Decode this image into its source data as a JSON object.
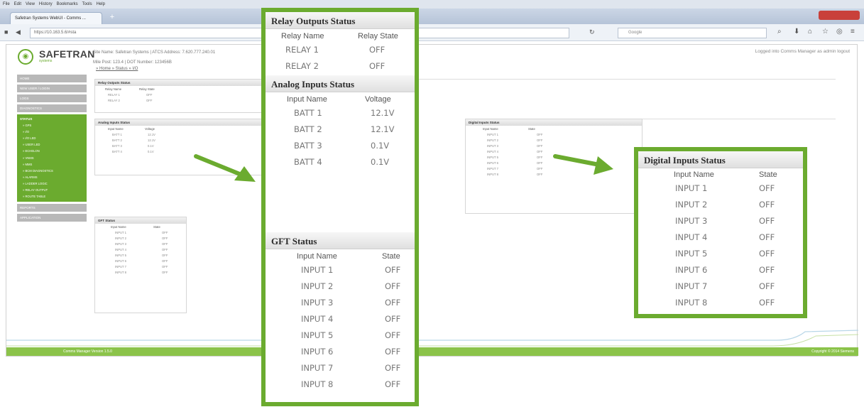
{
  "browser": {
    "menu": [
      "File",
      "Edit",
      "View",
      "History",
      "Bookmarks",
      "Tools",
      "Help"
    ],
    "tab_title": "Safetran Systems WebUI - Comms ...",
    "url": "https://10.163.5.6/#sta",
    "search_placeholder": "Google"
  },
  "header": {
    "logo": "SAFETRAN",
    "logo_sub": "systems",
    "site_line": "Site Name: Safetran Systems | ATCS Address: 7.620.777.240.01",
    "mile_line": "Mile Post: 123.4          | DOT Number: 123456B",
    "breadcrumb": "» Home » Status » I/O",
    "login_text": "Logged into Comms Manager as admin  logout"
  },
  "sidenav": {
    "top_items": [
      "HOME",
      "NEW USER / LOGIN",
      "LOGS",
      "DIAGNOSTICS"
    ],
    "status_group": {
      "label": "STATUS",
      "items": [
        "» GPS",
        "» I/O",
        "» I/O LED",
        "» USER LED",
        "» ECHELON",
        "» VNMS",
        "» MMS",
        "» BCM DIAGNOSTICS",
        "» ALARMS",
        "» LADDER LOGIC",
        "» RELAY OUTPUT",
        "» ROUTE TABLE"
      ]
    },
    "bottom_items": [
      "REPORTS",
      "APPLICATION"
    ]
  },
  "mini_panels": {
    "relay": {
      "title": "Relay Outputs Status",
      "headers": [
        "Relay Name",
        "Relay State"
      ],
      "rows": [
        [
          "RELAY 1",
          "OFF"
        ],
        [
          "RELAY 2",
          "OFF"
        ]
      ]
    },
    "analog": {
      "title": "Analog Inputs Status",
      "headers": [
        "Input Name",
        "Voltage"
      ],
      "rows": [
        [
          "BATT 1",
          "12.1V"
        ],
        [
          "BATT 2",
          "12.1V"
        ],
        [
          "BATT 3",
          "0.1V"
        ],
        [
          "BATT 4",
          "0.1V"
        ]
      ]
    },
    "digital": {
      "title": "Digital Inputs Status",
      "headers": [
        "Input Name",
        "State"
      ],
      "rows": [
        [
          "INPUT 1",
          "OFF"
        ],
        [
          "INPUT 2",
          "OFF"
        ],
        [
          "INPUT 3",
          "OFF"
        ],
        [
          "INPUT 4",
          "OFF"
        ],
        [
          "INPUT 5",
          "OFF"
        ],
        [
          "INPUT 6",
          "OFF"
        ],
        [
          "INPUT 7",
          "OFF"
        ],
        [
          "INPUT 8",
          "OFF"
        ]
      ]
    },
    "gft": {
      "title": "GFT Status",
      "headers": [
        "Input Name",
        "State"
      ],
      "rows": [
        [
          "INPUT 1",
          "OFF"
        ],
        [
          "INPUT 2",
          "OFF"
        ],
        [
          "INPUT 3",
          "OFF"
        ],
        [
          "INPUT 4",
          "OFF"
        ],
        [
          "INPUT 5",
          "OFF"
        ],
        [
          "INPUT 6",
          "OFF"
        ],
        [
          "INPUT 7",
          "OFF"
        ],
        [
          "INPUT 8",
          "OFF"
        ]
      ]
    }
  },
  "footer": {
    "version": "Comms Manager Version 1.5.0",
    "copyright": "Copyright © 2014 Siemens"
  },
  "callouts": {
    "relay": {
      "title": "Relay Outputs Status",
      "headers": [
        "Relay Name",
        "Relay State"
      ],
      "rows": [
        [
          "RELAY 1",
          "OFF"
        ],
        [
          "RELAY 2",
          "OFF"
        ]
      ]
    },
    "analog": {
      "title": "Analog Inputs Status",
      "headers": [
        "Input Name",
        "Voltage"
      ],
      "rows": [
        [
          "BATT 1",
          "12.1V"
        ],
        [
          "BATT 2",
          "12.1V"
        ],
        [
          "BATT 3",
          "0.1V"
        ],
        [
          "BATT 4",
          "0.1V"
        ]
      ]
    },
    "gft": {
      "title": "GFT Status",
      "headers": [
        "Input Name",
        "State"
      ],
      "rows": [
        [
          "INPUT 1",
          "OFF"
        ],
        [
          "INPUT 2",
          "OFF"
        ],
        [
          "INPUT 3",
          "OFF"
        ],
        [
          "INPUT 4",
          "OFF"
        ],
        [
          "INPUT 5",
          "OFF"
        ],
        [
          "INPUT 6",
          "OFF"
        ],
        [
          "INPUT 7",
          "OFF"
        ],
        [
          "INPUT 8",
          "OFF"
        ]
      ]
    },
    "digital": {
      "title": "Digital Inputs Status",
      "headers": [
        "Input Name",
        "State"
      ],
      "rows": [
        [
          "INPUT 1",
          "OFF"
        ],
        [
          "INPUT 2",
          "OFF"
        ],
        [
          "INPUT 3",
          "OFF"
        ],
        [
          "INPUT 4",
          "OFF"
        ],
        [
          "INPUT 5",
          "OFF"
        ],
        [
          "INPUT 6",
          "OFF"
        ],
        [
          "INPUT 7",
          "OFF"
        ],
        [
          "INPUT 8",
          "OFF"
        ]
      ]
    }
  },
  "colors": {
    "accent": "#6bab2f",
    "nav_gray": "#b8b8b8"
  }
}
